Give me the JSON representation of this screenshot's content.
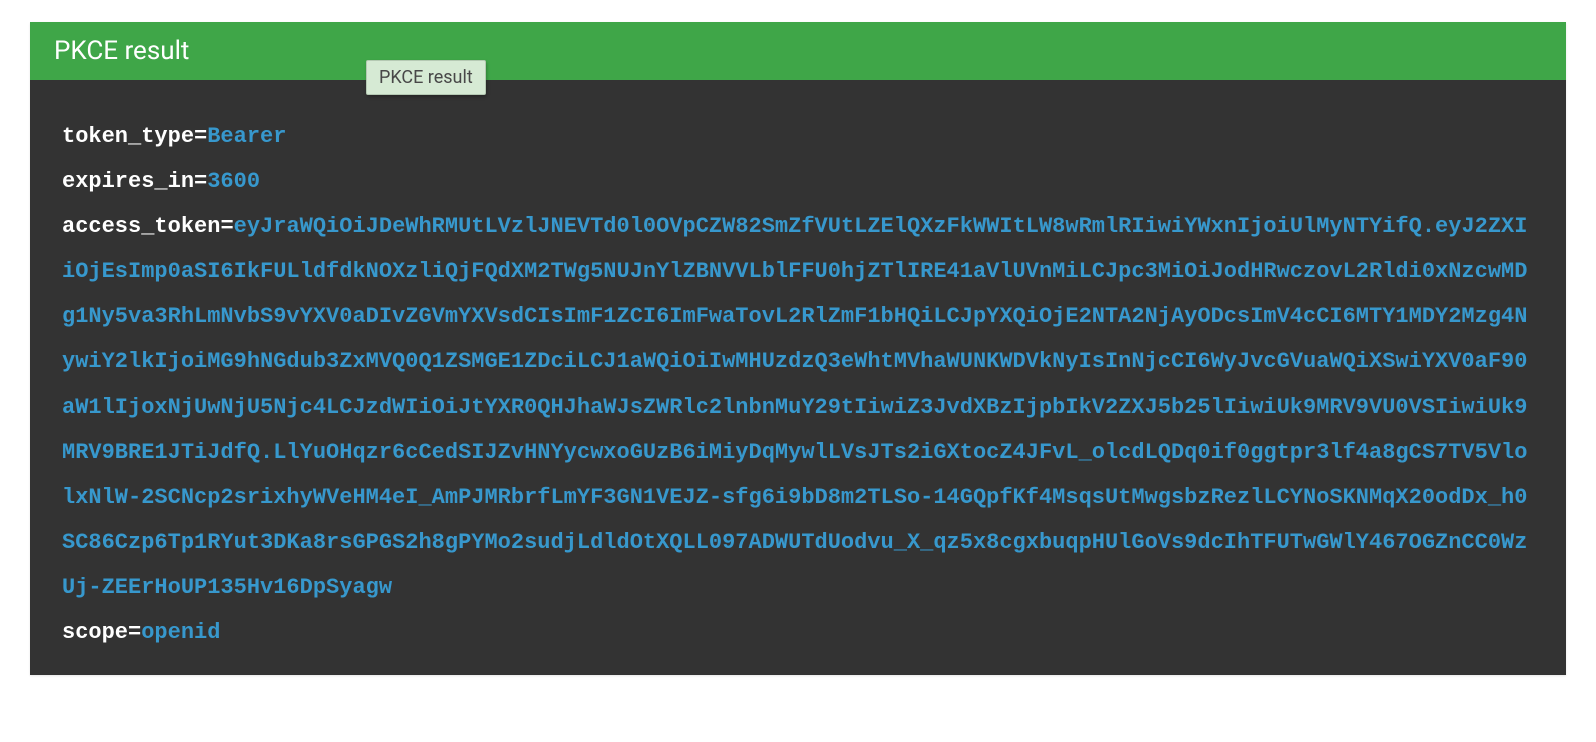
{
  "header": {
    "title": "PKCE result"
  },
  "tooltip": {
    "text": "PKCE result"
  },
  "result": {
    "items": [
      {
        "key": "token_type",
        "value": "Bearer"
      },
      {
        "key": "expires_in",
        "value": "3600"
      },
      {
        "key": "access_token",
        "value": "eyJraWQiOiJDeWhRMUtLVzlJNEVTd0l0OVpCZW82SmZfVUtLZElQXzFkWWItLW8wRmlRIiwiYWxnIjoiUlMyNTYifQ.eyJ2ZXIiOjEsImp0aSI6IkFULldfdkNOXzliQjFQdXM2TWg5NUJnYlZBNVVLblFFU0hjZTlIRE41aVlUVnMiLCJpc3MiOiJodHRwczovL2Rldi0xNzcwMDg1Ny5va3RhLmNvbS9vYXV0aDIvZGVmYXVsdCIsImF1ZCI6ImFwaTovL2RlZmF1bHQiLCJpYXQiOjE2NTA2NjAyODcsImV4cCI6MTY1MDY2Mzg4NywiY2lkIjoiMG9hNGdub3ZxMVQ0Q1ZSMGE1ZDciLCJ1aWQiOiIwMHUzdzQ3eWhtMVhaWUNKWDVkNyIsInNjcCI6WyJvcGVuaWQiXSwiYXV0aF90aW1lIjoxNjUwNjU5Njc4LCJzdWIiOiJtYXR0QHJhaWJsZWRlc2lnbnMuY29tIiwiZ3JvdXBzIjpbIkV2ZXJ5b25lIiwiUk9MRV9VU0VSIiwiUk9MRV9BRE1JTiJdfQ.LlYuOHqzr6cCedSIJZvHNYycwxoGUzB6iMiyDqMywlLVsJTs2iGXtocZ4JFvL_olcdLQDq0if0ggtpr3lf4a8gCS7TV5VlolxNlW-2SCNcp2srixhyWVeHM4eI_AmPJMRbrfLmYF3GN1VEJZ-sfg6i9bD8m2TLSo-14GQpfKf4MsqsUtMwgsbzRezlLCYNoSKNMqX20odDx_h0SC86Czp6Tp1RYut3DKa8rsGPGS2h8gPYMo2sudjLdldOtXQLL097ADWUTdUodvu_X_qz5x8cgxbuqpHUlGoVs9dcIhTFUTwGWlY467OGZnCC0WzUj-ZEErHoUP135Hv16DpSyagw"
      },
      {
        "key": "scope",
        "value": "openid"
      }
    ]
  }
}
